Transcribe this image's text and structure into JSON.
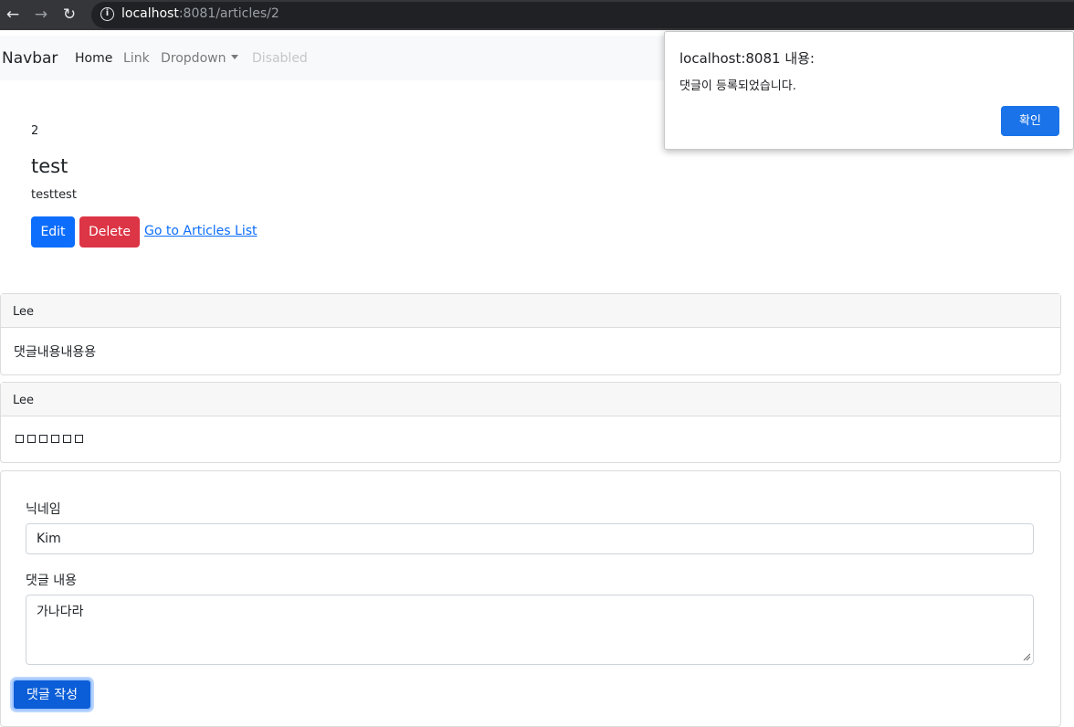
{
  "browser": {
    "url_host": "localhost",
    "url_rest": ":8081/articles/2",
    "back_icon": "arrow-left-icon",
    "forward_icon": "arrow-right-icon",
    "reload_icon": "reload-icon",
    "info_icon": "info-icon"
  },
  "navbar": {
    "brand": "Navbar",
    "items": [
      {
        "label": "Home"
      },
      {
        "label": "Link"
      },
      {
        "label": "Dropdown"
      },
      {
        "label": "Disabled"
      }
    ]
  },
  "article": {
    "id": "2",
    "title": "test",
    "content": "testtest",
    "edit_label": "Edit",
    "delete_label": "Delete",
    "list_link": "Go to Articles List"
  },
  "comments": [
    {
      "nickname": "Lee",
      "body": "댓글내용내용용"
    },
    {
      "nickname": "Lee",
      "body_glyph_count": 6
    }
  ],
  "form": {
    "nickname_label": "닉네임",
    "nickname_value": "Kim",
    "body_label": "댓글 내용",
    "body_value": "가나다라",
    "submit_label": "댓글 작성"
  },
  "dialog": {
    "title": "localhost:8081 내용:",
    "message": "댓글이 등록되었습니다.",
    "ok_label": "확인"
  },
  "colors": {
    "primary": "#0d6efd",
    "danger": "#dc3545",
    "dialog_button": "#1a73e8"
  }
}
